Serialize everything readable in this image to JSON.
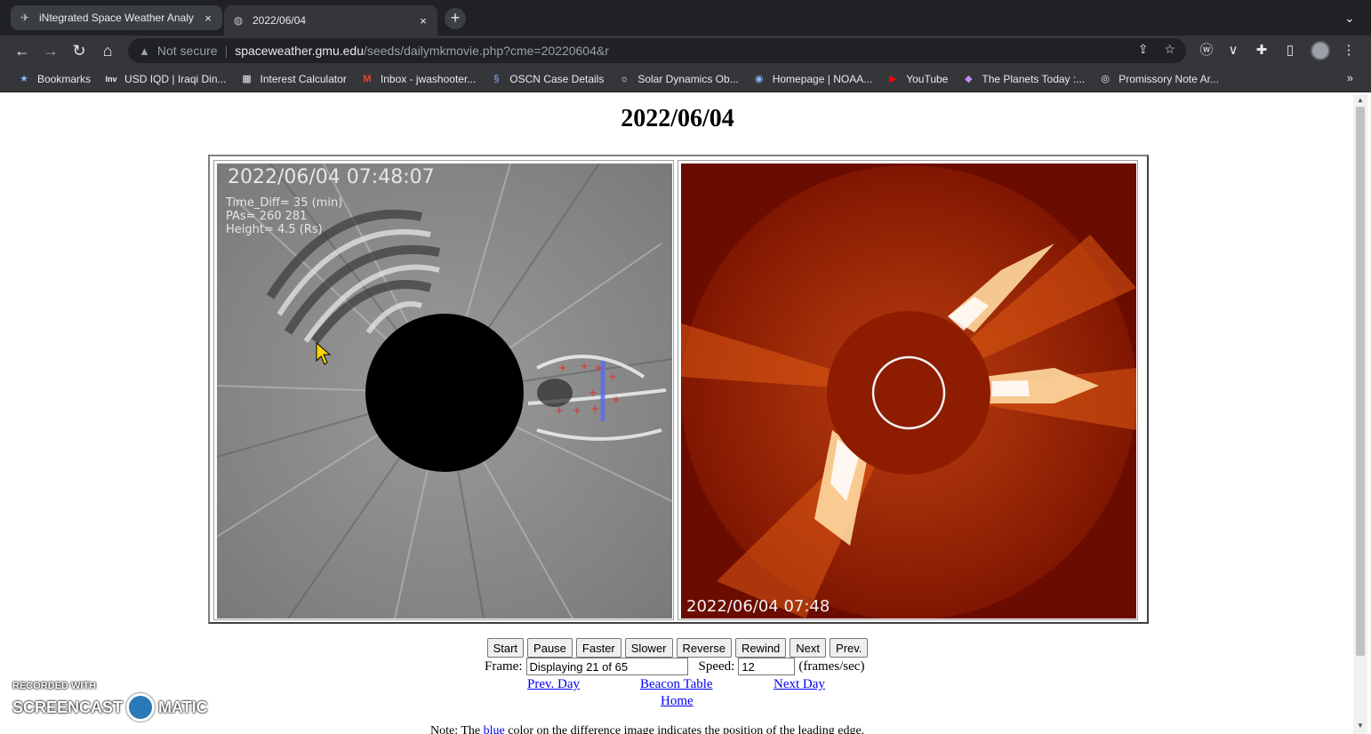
{
  "browser": {
    "tabs": [
      {
        "title": "iNtegrated Space Weather Analy",
        "icon": "satellite-icon",
        "close": "×"
      },
      {
        "title": "2022/06/04",
        "icon": "globe-icon",
        "close": "×"
      }
    ],
    "new_tab": "+",
    "security_label": "Not secure",
    "url_host": "spaceweather.gmu.edu",
    "url_path": "/seeds/dailymkmovie.php?cme=20220604&r",
    "bookmarks": [
      {
        "label": "Bookmarks",
        "icon": "star-icon"
      },
      {
        "label": "USD IQD | Iraqi Din...",
        "icon": "inv-icon"
      },
      {
        "label": "Interest Calculator",
        "icon": "calculator-icon"
      },
      {
        "label": "Inbox - jwashooter...",
        "icon": "gmail-icon"
      },
      {
        "label": "OSCN Case Details",
        "icon": "shield-icon"
      },
      {
        "label": "Solar Dynamics Ob...",
        "icon": "sdo-icon"
      },
      {
        "label": "Homepage | NOAA...",
        "icon": "noaa-icon"
      },
      {
        "label": "YouTube",
        "icon": "youtube-icon"
      },
      {
        "label": "The Planets Today :...",
        "icon": "planets-icon"
      },
      {
        "label": "Promissory Note Ar...",
        "icon": "document-icon"
      }
    ],
    "bookmarks_more": "»"
  },
  "page": {
    "title": "2022/06/04",
    "left_image": {
      "timestamp": "2022/06/04 07:48:07",
      "time_diff": "Time_Diff= 35 (min)",
      "pas": "PAs= 260 281",
      "height": "Height= 4.5 (Rs)"
    },
    "right_image": {
      "timestamp": "2022/06/04 07:48"
    },
    "controls": [
      "Start",
      "Pause",
      "Faster",
      "Slower",
      "Reverse",
      "Rewind",
      "Next",
      "Prev."
    ],
    "frame_label": "Frame:",
    "frame_value": "Displaying 21 of 65",
    "speed_label": "Speed:",
    "speed_value": "12",
    "speed_unit": "(frames/sec)",
    "links": {
      "prev_day": "Prev. Day",
      "beacon_table": "Beacon Table",
      "next_day": "Next Day",
      "home": "Home"
    },
    "note_prefix": "Note: The",
    "note_blue": "blue",
    "note_suffix": "color on the difference image indicates the position of the leading edge."
  },
  "watermark": {
    "recorded": "RECORDED WITH",
    "brand_left": "SCREENCAST",
    "brand_right": "MATIC"
  },
  "colors": {
    "chrome_dark": "#202124",
    "chrome_toolbar": "#35363a",
    "link_blue": "#0000ee",
    "lasco_red": "#8b1a00"
  }
}
